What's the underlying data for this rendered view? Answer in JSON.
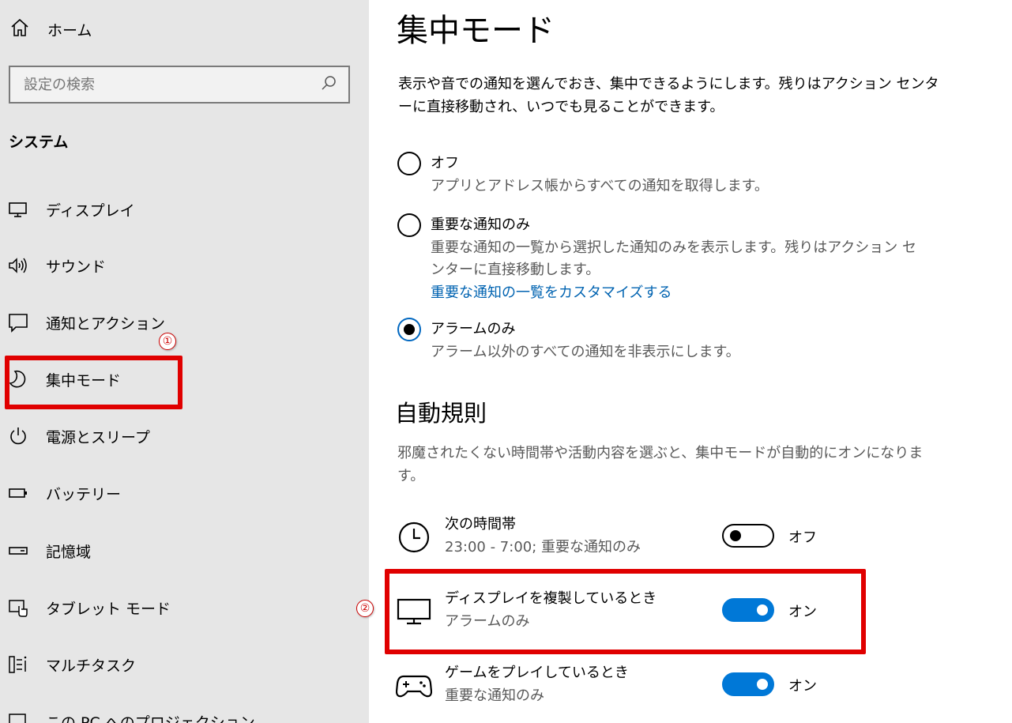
{
  "sidebar": {
    "home_label": "ホーム",
    "search_placeholder": "設定の検索",
    "section_title": "システム",
    "items": [
      {
        "label": "ディスプレイ",
        "icon": "monitor-icon"
      },
      {
        "label": "サウンド",
        "icon": "speaker-icon"
      },
      {
        "label": "通知とアクション",
        "icon": "notification-icon"
      },
      {
        "label": "集中モード",
        "icon": "moon-icon"
      },
      {
        "label": "電源とスリープ",
        "icon": "power-icon"
      },
      {
        "label": "バッテリー",
        "icon": "battery-icon"
      },
      {
        "label": "記憶域",
        "icon": "storage-icon"
      },
      {
        "label": "タブレット モード",
        "icon": "tablet-mode-icon"
      },
      {
        "label": "マルチタスク",
        "icon": "multitask-icon"
      },
      {
        "label": "この PC へのプロジェクション",
        "icon": "projection-icon"
      }
    ]
  },
  "annotations": {
    "badge1": "①",
    "badge2": "②",
    "highlight_color": "#e00000"
  },
  "main": {
    "title": "集中モード",
    "description": "表示や音での通知を選んでおき、集中できるようにします。残りはアクション センターに直接移動され、いつでも見ることができます。",
    "options": [
      {
        "label": "オフ",
        "desc": "アプリとアドレス帳からすべての通知を取得します。",
        "checked": false
      },
      {
        "label": "重要な通知のみ",
        "desc": "重要な通知の一覧から選択した通知のみを表示します。残りはアクション センターに直接移動します。",
        "link": "重要な通知の一覧をカスタマイズする",
        "checked": false
      },
      {
        "label": "アラームのみ",
        "desc": "アラーム以外のすべての通知を非表示にします。",
        "checked": true
      }
    ],
    "auto_rules_title": "自動規則",
    "auto_rules_desc": "邪魔されたくない時間帯や活動内容を選ぶと、集中モードが自動的にオンになります。",
    "rules": [
      {
        "name": "次の時間帯",
        "detail": "23:00 - 7:00; 重要な通知のみ",
        "state": "オフ",
        "on": false,
        "icon": "clock-icon"
      },
      {
        "name": "ディスプレイを複製しているとき",
        "detail": "アラームのみ",
        "state": "オン",
        "on": true,
        "icon": "monitor-icon"
      },
      {
        "name": "ゲームをプレイしているとき",
        "detail": "重要な通知のみ",
        "state": "オン",
        "on": true,
        "icon": "gamepad-icon"
      }
    ]
  },
  "colors": {
    "sidebar_bg": "#e6e6e6",
    "accent": "#0078d7",
    "link": "#0063b1"
  }
}
